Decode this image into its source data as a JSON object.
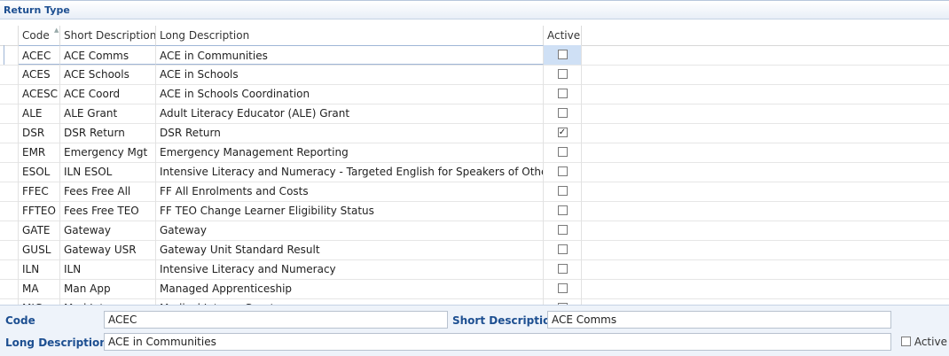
{
  "panel": {
    "title": "Return Type"
  },
  "columns": {
    "code": "Code",
    "short": "Short Description",
    "long": "Long Description",
    "active": "Active"
  },
  "rows": [
    {
      "code": "ACEC",
      "short": "ACE Comms",
      "long": "ACE in Communities",
      "active": false
    },
    {
      "code": "ACES",
      "short": "ACE Schools",
      "long": "ACE in Schools",
      "active": false
    },
    {
      "code": "ACESC",
      "short": "ACE Coord",
      "long": "ACE in Schools Coordination",
      "active": false
    },
    {
      "code": "ALE",
      "short": "ALE Grant",
      "long": "Adult Literacy Educator (ALE) Grant",
      "active": false
    },
    {
      "code": "DSR",
      "short": "DSR Return",
      "long": "DSR Return",
      "active": true
    },
    {
      "code": "EMR",
      "short": "Emergency Mgt",
      "long": "Emergency Management Reporting",
      "active": false
    },
    {
      "code": "ESOL",
      "short": "ILN ESOL",
      "long": "Intensive Literacy and Numeracy - Targeted English for Speakers of Other L",
      "active": false
    },
    {
      "code": "FFEC",
      "short": "Fees Free All",
      "long": "FF All Enrolments and Costs",
      "active": false
    },
    {
      "code": "FFTEO",
      "short": "Fees Free TEO",
      "long": "FF TEO Change Learner Eligibility Status",
      "active": false
    },
    {
      "code": "GATE",
      "short": "Gateway",
      "long": "Gateway",
      "active": false
    },
    {
      "code": "GUSL",
      "short": "Gateway USR",
      "long": "Gateway Unit Standard Result",
      "active": false
    },
    {
      "code": "ILN",
      "short": "ILN",
      "long": "Intensive Literacy and Numeracy",
      "active": false
    },
    {
      "code": "MA",
      "short": "Man App",
      "long": "Managed Apprenticeship",
      "active": false
    },
    {
      "code": "MIG",
      "short": "Med Interns",
      "long": "Medical Interns Grant",
      "active": false
    }
  ],
  "selected_index": 0,
  "editor": {
    "code_label": "Code",
    "code_value": "ACEC",
    "short_label": "Short Description",
    "short_value": "ACE Comms",
    "long_label": "Long Description",
    "long_value": "ACE in Communities",
    "active_label": "Active",
    "active_checked": false
  },
  "colors": {
    "accent": "#1d4f91",
    "selection": "#cfe0f5",
    "editor_bg": "#eef3fa"
  }
}
